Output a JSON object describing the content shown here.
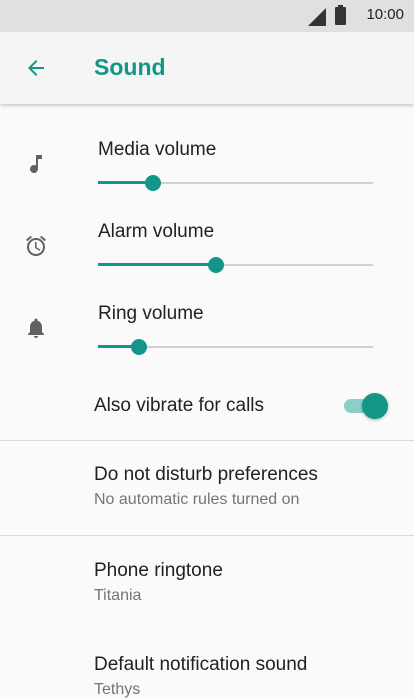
{
  "status_bar": {
    "time": "10:00",
    "icons": [
      "signal-icon",
      "battery-icon"
    ]
  },
  "app_bar": {
    "title": "Sound",
    "back_icon": "arrow-back-icon"
  },
  "colors": {
    "accent": "#129688",
    "accent_light": "#8ccfc8",
    "text_primary": "#212121",
    "text_secondary": "#757575",
    "icon": "#616161"
  },
  "sliders": [
    {
      "label": "Media volume",
      "icon": "music-note-icon",
      "level": 0.2
    },
    {
      "label": "Alarm volume",
      "icon": "alarm-clock-icon",
      "level": 0.43
    },
    {
      "label": "Ring volume",
      "icon": "bell-icon",
      "level": 0.15
    }
  ],
  "vibrate": {
    "label": "Also vibrate for calls",
    "enabled": true
  },
  "preferences": [
    {
      "title": "Do not disturb preferences",
      "summary": "No automatic rules turned on"
    },
    {
      "title": "Phone ringtone",
      "summary": "Titania"
    },
    {
      "title": "Default notification sound",
      "summary": "Tethys"
    }
  ]
}
